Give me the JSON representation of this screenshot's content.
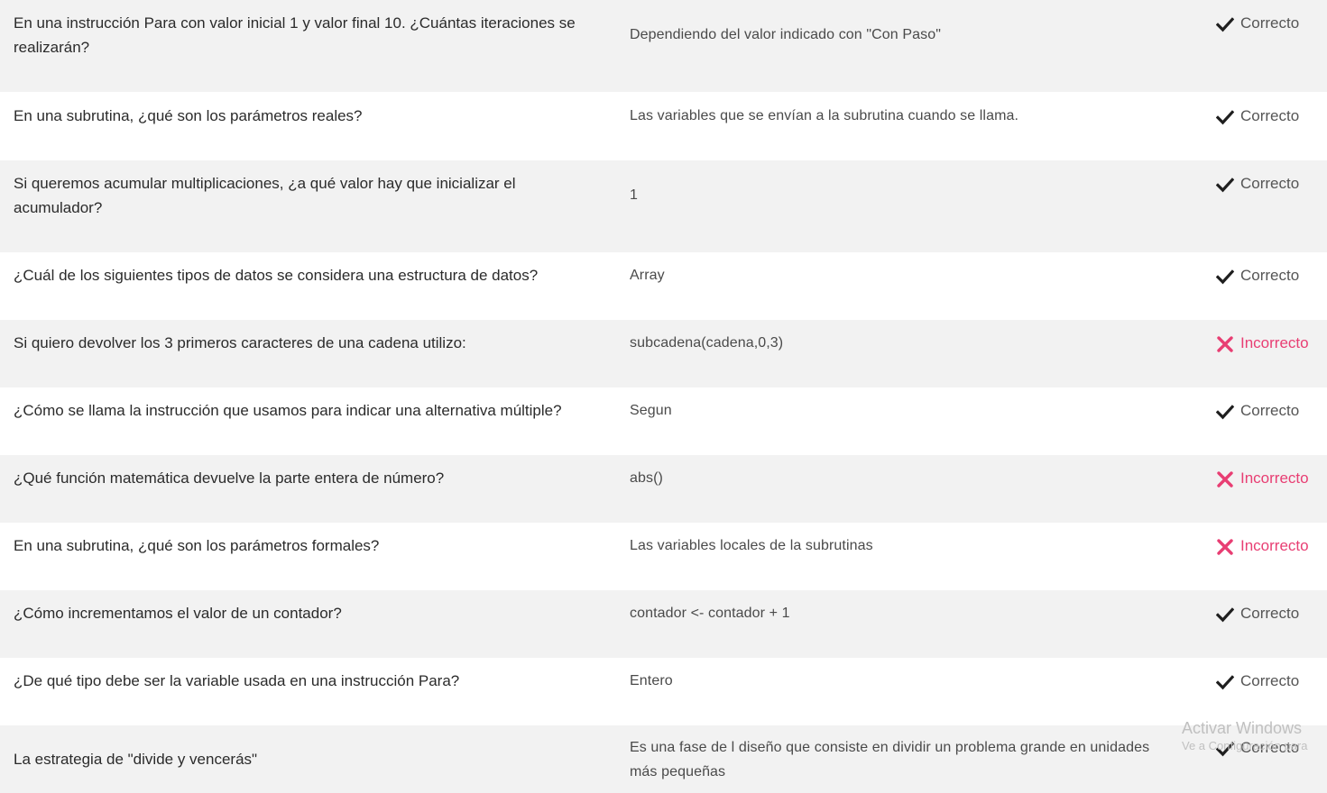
{
  "status_labels": {
    "correct": "Correcto",
    "incorrect": "Incorrecto"
  },
  "icons": {
    "correct": "check-icon",
    "incorrect": "cross-icon"
  },
  "colors": {
    "row_shade": "#f2f2f2",
    "row_plain": "#ffffff",
    "correct_text": "#555555",
    "incorrect_accent": "#e83e73"
  },
  "results": [
    {
      "question": "En una instrucción Para con valor inicial 1 y valor final 10. ¿Cuántas iteraciones se realizarán?",
      "answer": "Dependiendo del valor indicado con \"Con Paso\"",
      "status": "correct"
    },
    {
      "question": "En una subrutina, ¿qué son los parámetros reales?",
      "answer": "Las variables que se envían a la subrutina cuando se llama.",
      "status": "correct"
    },
    {
      "question": "Si queremos acumular multiplicaciones, ¿a qué valor hay que inicializar el acumulador?",
      "answer": "1",
      "status": "correct"
    },
    {
      "question": "¿Cuál de los siguientes tipos de datos se considera una estructura de datos?",
      "answer": "Array",
      "status": "correct"
    },
    {
      "question": "Si quiero devolver los 3 primeros caracteres de una cadena utilizo:",
      "answer": "subcadena(cadena,0,3)",
      "status": "incorrect"
    },
    {
      "question": "¿Cómo se llama la instrucción que usamos para indicar una alternativa múltiple?",
      "answer": "Segun",
      "status": "correct"
    },
    {
      "question": "¿Qué función matemática devuelve la parte entera de número?",
      "answer": "abs()",
      "status": "incorrect"
    },
    {
      "question": "En una subrutina, ¿qué son los parámetros formales?",
      "answer": "Las variables locales de la subrutinas",
      "status": "incorrect"
    },
    {
      "question": "¿Cómo incrementamos el valor de un contador?",
      "answer": "contador <- contador + 1",
      "status": "correct"
    },
    {
      "question": "¿De qué tipo debe ser la variable usada en una instrucción Para?",
      "answer": "Entero",
      "status": "correct"
    },
    {
      "question": "La estrategia de \"divide y vencerás\"",
      "answer": "Es una fase de l diseño que consiste en dividir un problema grande en unidades más pequeñas",
      "status": "correct"
    }
  ],
  "watermark": {
    "title": "Activar Windows",
    "subtitle": "Ve a Configuración para"
  }
}
